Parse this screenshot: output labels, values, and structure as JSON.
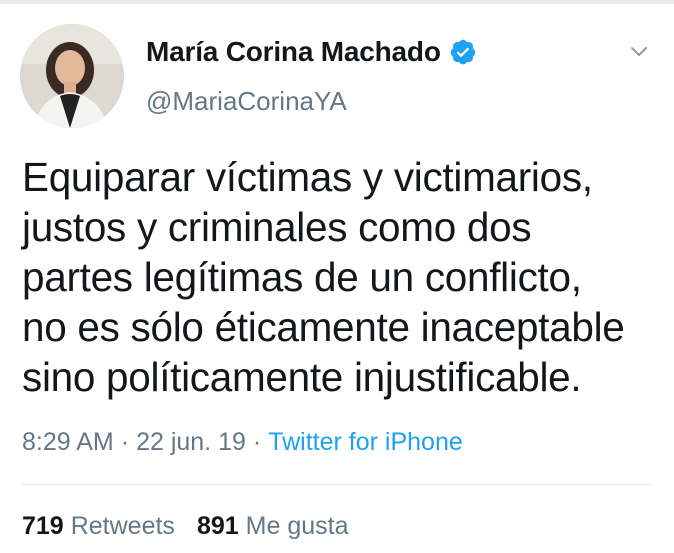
{
  "author": {
    "display_name": "María Corina Machado",
    "handle": "@MariaCorinaYA",
    "verified": true
  },
  "tweet": {
    "text": "Equiparar víctimas y victimarios,\njustos y criminales como dos\npartes legítimas de un conflicto,\nno es sólo éticamente inaceptable\nsino políticamente injustificable.",
    "time": "8:29 AM",
    "date": "22 jun. 19",
    "separator": "·",
    "source": "Twitter for iPhone"
  },
  "stats": {
    "retweets_count": "719",
    "retweets_label": "Retweets",
    "likes_count": "891",
    "likes_label": "Me gusta"
  },
  "colors": {
    "accent": "#1da1f2",
    "text": "#14171a",
    "muted": "#657786"
  },
  "icons": {
    "verified": "verified-badge-icon",
    "menu": "chevron-down-icon"
  }
}
